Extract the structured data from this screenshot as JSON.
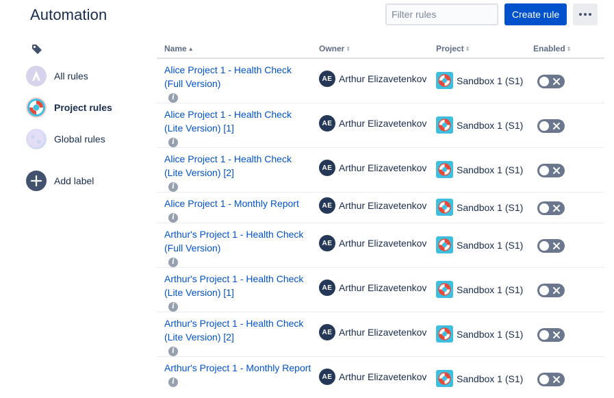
{
  "header": {
    "title": "Automation",
    "filter_placeholder": "Filter rules",
    "create_label": "Create rule"
  },
  "sidebar": {
    "items": [
      {
        "label": "All rules",
        "icon": "atlassian-logo-icon",
        "active": false
      },
      {
        "label": "Project rules",
        "icon": "lifebuoy-icon",
        "active": true
      },
      {
        "label": "Global rules",
        "icon": "globe-icon",
        "active": false
      },
      {
        "label": "Add label",
        "icon": "plus-icon",
        "active": false
      }
    ]
  },
  "table": {
    "columns": [
      "Name",
      "Owner",
      "Project",
      "Enabled"
    ],
    "rows": [
      {
        "name": "Alice Project 1 - Health Check (Full Version)",
        "owner_initials": "AE",
        "owner": "Arthur Elizavetenkov",
        "project": "Sandbox 1 (S1)",
        "enabled": false
      },
      {
        "name": "Alice Project 1 - Health Check (Lite Version) [1]",
        "owner_initials": "AE",
        "owner": "Arthur Elizavetenkov",
        "project": "Sandbox 1 (S1)",
        "enabled": false
      },
      {
        "name": "Alice Project 1 - Health Check (Lite Version) [2]",
        "owner_initials": "AE",
        "owner": "Arthur Elizavetenkov",
        "project": "Sandbox 1 (S1)",
        "enabled": false
      },
      {
        "name": "Alice Project 1 - Monthly Report",
        "owner_initials": "AE",
        "owner": "Arthur Elizavetenkov",
        "project": "Sandbox 1 (S1)",
        "enabled": false
      },
      {
        "name": "Arthur's Project 1 - Health Check (Full Version)",
        "owner_initials": "AE",
        "owner": "Arthur Elizavetenkov",
        "project": "Sandbox 1 (S1)",
        "enabled": false
      },
      {
        "name": "Arthur's Project 1 - Health Check (Lite Version) [1]",
        "owner_initials": "AE",
        "owner": "Arthur Elizavetenkov",
        "project": "Sandbox 1 (S1)",
        "enabled": false
      },
      {
        "name": "Arthur's Project 1 - Health Check (Lite Version) [2]",
        "owner_initials": "AE",
        "owner": "Arthur Elizavetenkov",
        "project": "Sandbox 1 (S1)",
        "enabled": false
      },
      {
        "name": "Arthur's Project 1 - Monthly Report",
        "owner_initials": "AE",
        "owner": "Arthur Elizavetenkov",
        "project": "Sandbox 1 (S1)",
        "enabled": false
      }
    ]
  },
  "colors": {
    "primary": "#0052cc",
    "link": "#0052cc",
    "toggle_off": "#6b778c",
    "avatar": "#253858",
    "project_icon_bg": "#3ebfe0"
  }
}
